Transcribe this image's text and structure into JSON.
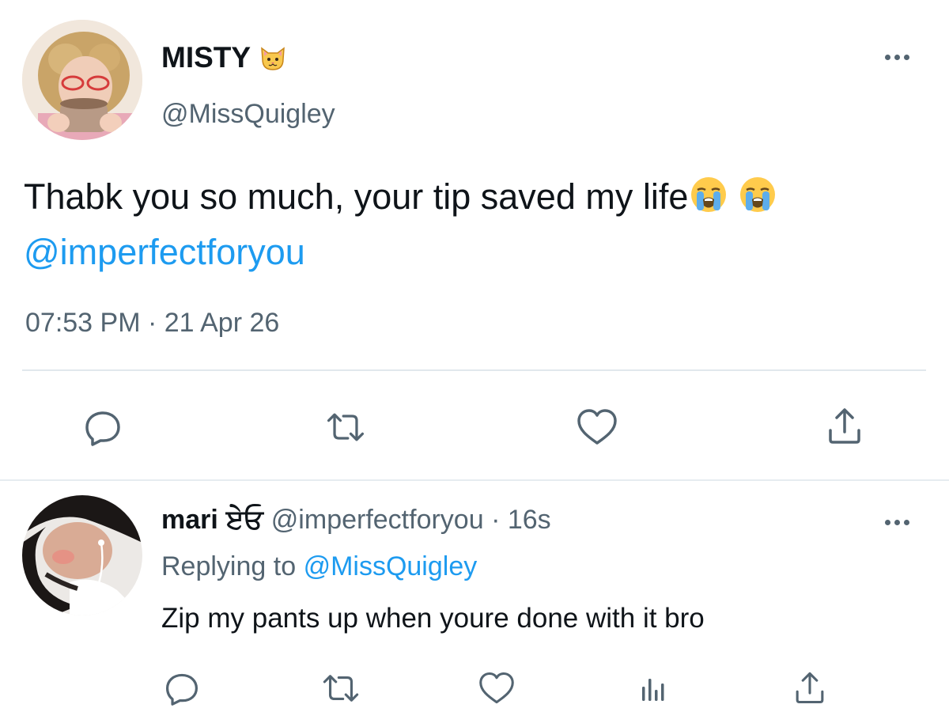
{
  "main_tweet": {
    "display_name": "MISTY",
    "name_emoji_icon": "cat-face-icon",
    "handle": "@MissQuigley",
    "text": "Thabk you so much, your tip saved my life",
    "text_emoji_icon": "loudly-crying-face-icon",
    "mention": "@imperfectforyou",
    "timestamp": "07:53 PM · 21 Apr 26",
    "actions": [
      "reply-icon",
      "retweet-icon",
      "like-icon",
      "share-icon"
    ]
  },
  "reply_tweet": {
    "display_name": "mari",
    "name_suffix": "ਏਓ",
    "handle_time": "@imperfectforyou · 16s",
    "replying_prefix": "Replying to",
    "replying_handle": "@MissQuigley",
    "text": "Zip my pants up when youre done with it bro",
    "actions": [
      "reply-icon",
      "retweet-icon",
      "like-icon",
      "analytics-icon",
      "share-icon"
    ]
  },
  "colors": {
    "text": "#0f1419",
    "muted": "#536471",
    "link": "#1d9bf0",
    "divider": "#e1e8ed"
  }
}
